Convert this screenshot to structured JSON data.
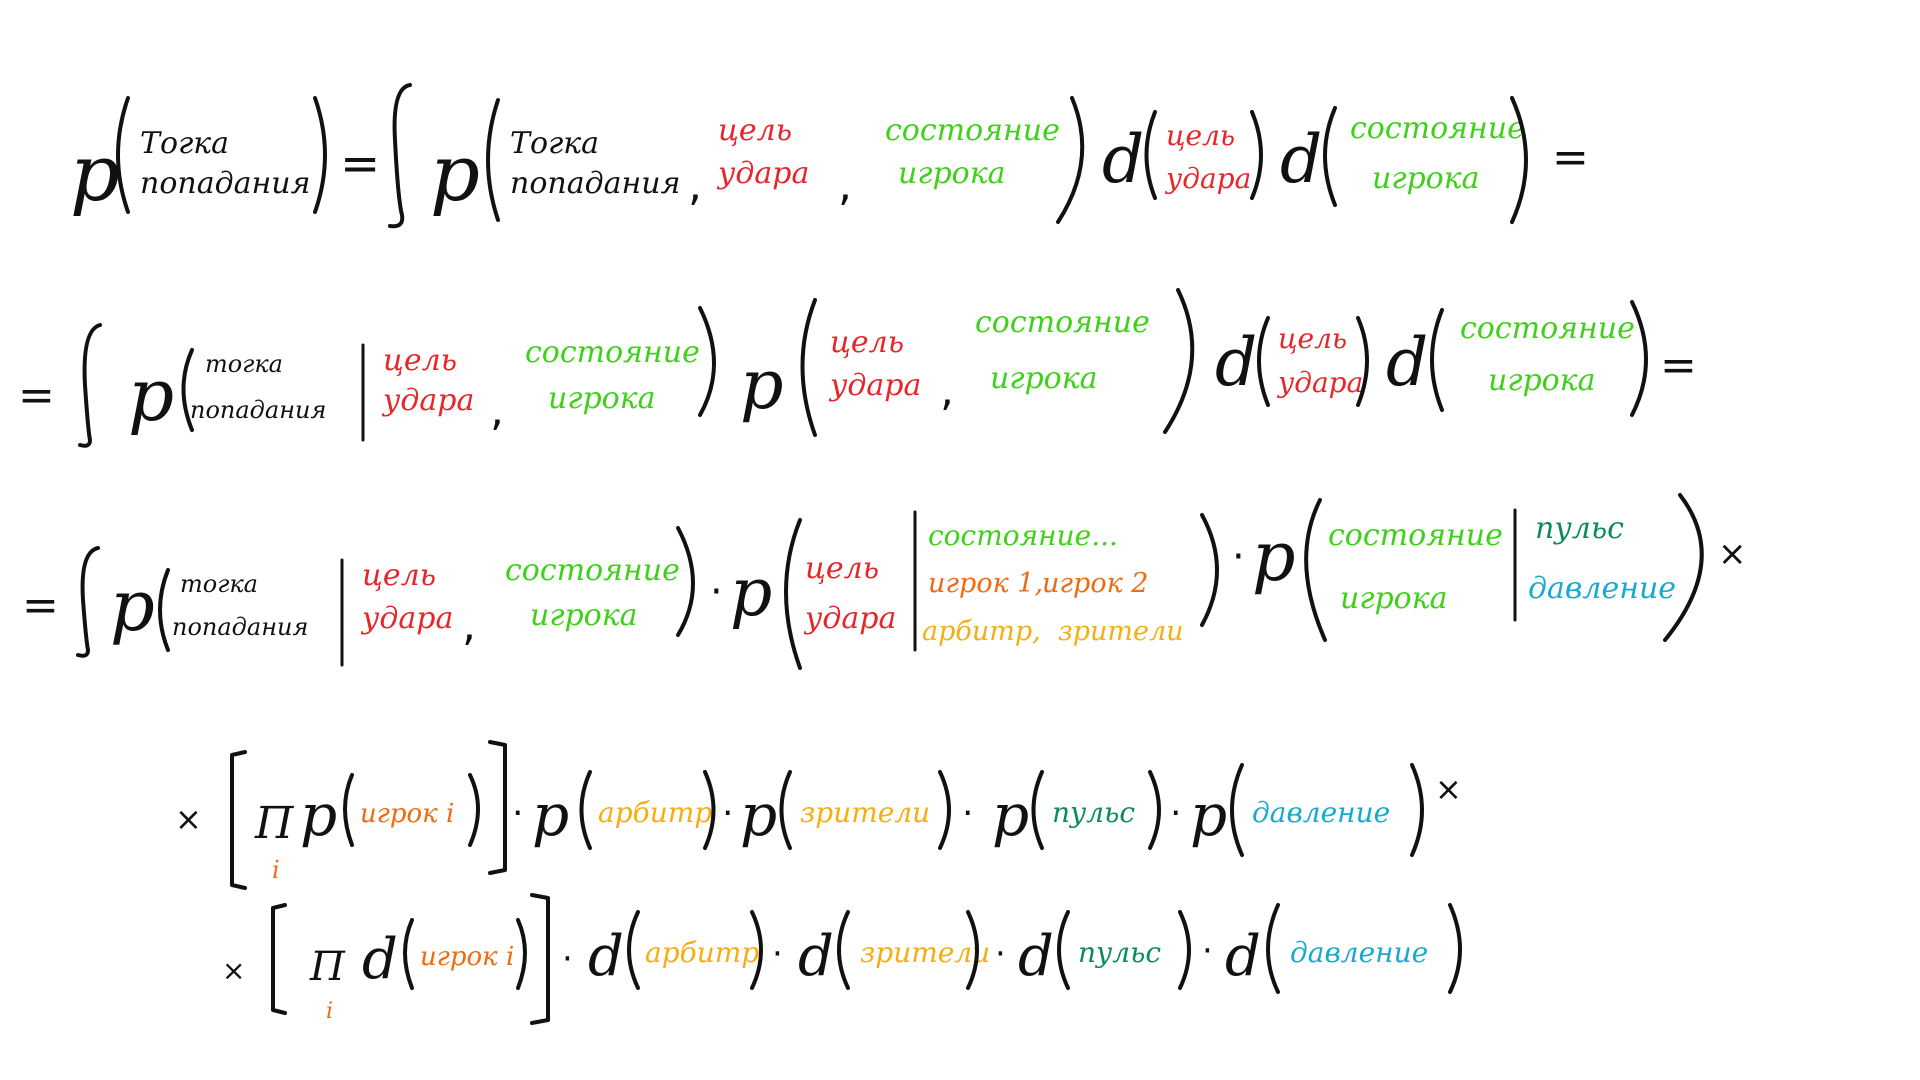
{
  "colors": {
    "ink": "#111111",
    "target": "#e8262a",
    "player_state": "#3fd11a",
    "players": "#f06a10",
    "referee_spectators": "#f6ae12",
    "pulse": "#0d8a5e",
    "pressure": "#18a9cf"
  },
  "words": {
    "tochka": "Тогка",
    "tochka_l": "тогка",
    "popadaniya": "попадания",
    "cel": "цель",
    "udara": "удара",
    "sostoyanie": "состояние",
    "sostoyanie_dots": "состояние...",
    "igroka": "игрока",
    "igrok1": "игрок 1,",
    "igrok2": "игрок 2",
    "arbitr": "арбитр,",
    "arbitr_plain": "арбитр",
    "zriteli": "зрители",
    "puls": "пульс",
    "davlenie": "давление",
    "igrok_i": "игрок i"
  },
  "symbols": {
    "p": "p",
    "d": "d",
    "eq": "=",
    "comma": ",",
    "dot": "·",
    "times": "×",
    "prod": "Π",
    "idx": "i"
  }
}
